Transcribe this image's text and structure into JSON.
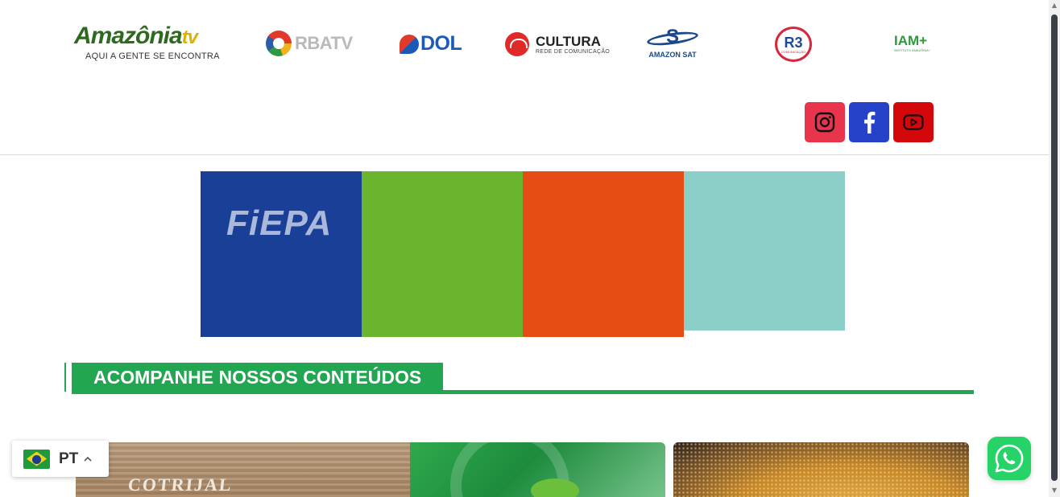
{
  "header": {
    "logos": {
      "amazonia": {
        "name": "Amazônia",
        "suffix": "tv",
        "tagline": "AQUI A GENTE SE ENCONTRA"
      },
      "rba": {
        "name": "RBATV"
      },
      "dol": {
        "name": "DOL"
      },
      "cultura": {
        "name": "CULTURA",
        "subtitle": "REDE DE COMUNICAÇÃO"
      },
      "amazonsat": {
        "name": "AMAZON SAT",
        "mark": "S"
      },
      "r3": {
        "name": "R3",
        "subtitle": "COMUNICAÇÃO"
      },
      "iam": {
        "name": "IAM+",
        "subtitle": "INSTITUTO AMAZÔNIA+"
      }
    },
    "social": [
      {
        "network": "instagram",
        "icon": "instagram-icon",
        "color": "#e8344c"
      },
      {
        "network": "facebook",
        "icon": "facebook-icon",
        "color": "#2542c8"
      },
      {
        "network": "youtube",
        "icon": "youtube-icon",
        "color": "#d4070b"
      }
    ]
  },
  "banner": {
    "brand": "FiEPA",
    "colors": [
      "#1a3f96",
      "#6ab42e",
      "#e64c16",
      "#8bcfc8"
    ]
  },
  "section": {
    "title": "ACOMPANHE NOSSOS CONTEÚDOS",
    "accent": "#22a652"
  },
  "cards": [
    {
      "image": "cooperative-building-photo",
      "sign": "COTRIJAL"
    },
    {
      "image": "grains-photo"
    }
  ],
  "language_switcher": {
    "code": "PT",
    "flag": "brazil-flag-icon",
    "caret": "chevron-up-icon"
  },
  "whatsapp": {
    "icon": "whatsapp-icon",
    "color": "#25d366"
  }
}
